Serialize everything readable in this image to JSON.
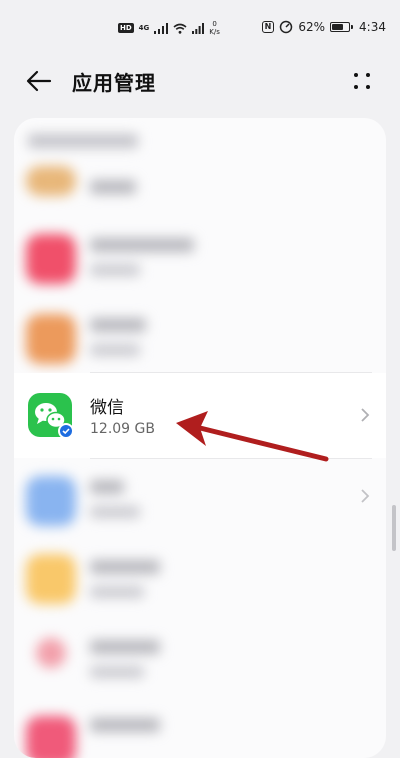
{
  "status_bar": {
    "hd_badge": "HD",
    "signal_gen": "4G",
    "net_speed_value": "0",
    "net_speed_unit": "K/s",
    "nfc_label": "N",
    "battery_percent": "62%",
    "battery_level": 0.62,
    "time": "4:34"
  },
  "header": {
    "title": "应用管理",
    "back_icon": "arrow-left-icon",
    "more_icon": "more-dots-icon"
  },
  "app_list": {
    "highlighted_app": {
      "name": "微信",
      "size": "12.09 GB",
      "icon": "wechat-icon"
    }
  },
  "colors": {
    "wechat_green": "#2bc24d",
    "badge_blue": "#1e6de0",
    "arrow_red": "#b01e1e",
    "blurred_icon_colors": [
      "#e8b77a",
      "#f0506a",
      "#ec9a5c",
      "#89b4f0",
      "#f9c86a",
      "#f2a0ab",
      "#f05a7a"
    ]
  }
}
